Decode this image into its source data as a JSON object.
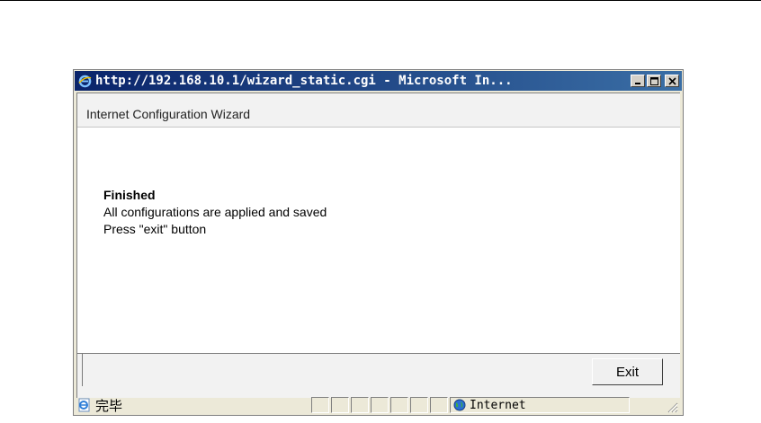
{
  "window": {
    "title": "http://192.168.10.1/wizard_static.cgi - Microsoft In...",
    "icons": {
      "title": "ie-icon",
      "minimize": "minimize-icon",
      "maximize": "maximize-icon",
      "close": "close-icon"
    }
  },
  "wizard": {
    "header_title": "Internet Configuration Wizard",
    "finished_label": "Finished",
    "message_line1": "All configurations are applied and saved",
    "message_line2": "Press \"exit\" button",
    "exit_button": "Exit"
  },
  "statusbar": {
    "status_text": "完毕",
    "zone_text": "Internet",
    "icons": {
      "page": "ie-page-icon",
      "zone": "globe-icon",
      "grip": "resize-grip-icon"
    }
  },
  "colors": {
    "titlebar_start": "#0a246a",
    "titlebar_end": "#3a6ea5",
    "chrome": "#ece9d8"
  }
}
